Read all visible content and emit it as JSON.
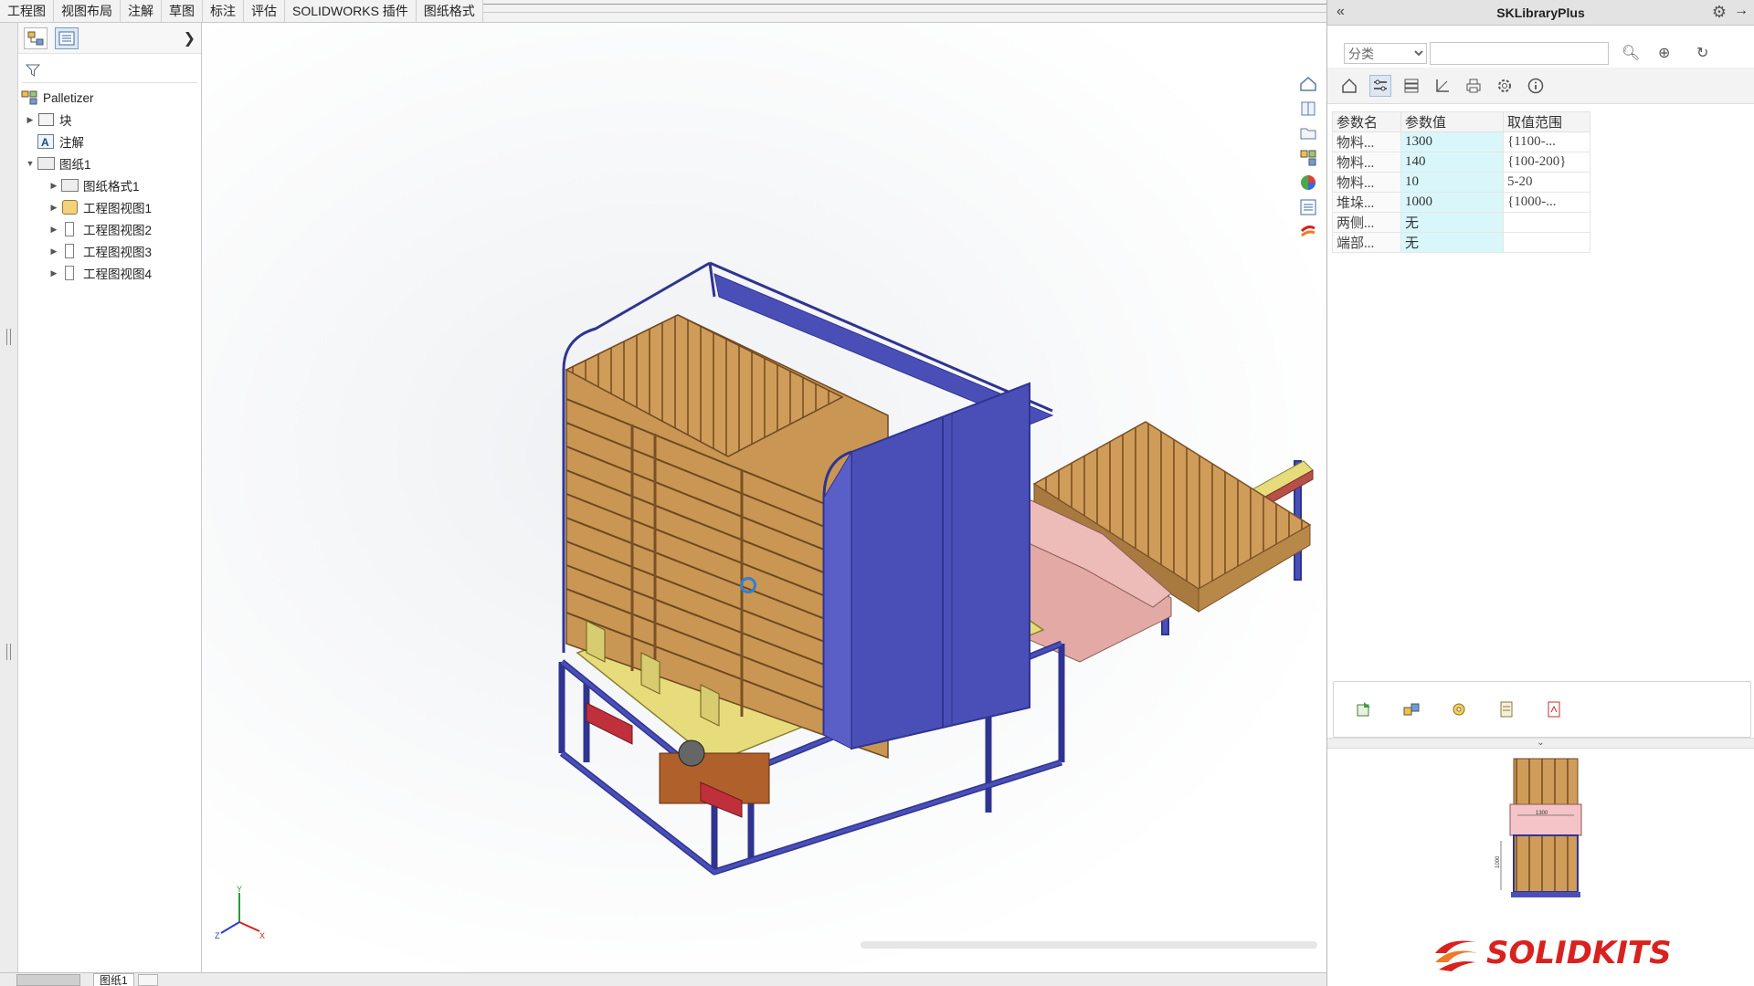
{
  "command_tabs": [
    "工程图",
    "视图布局",
    "注解",
    "草图",
    "标注",
    "评估",
    "SOLIDWORKS 插件",
    "图纸格式"
  ],
  "feature_tree": {
    "root": "Palletizer",
    "items": [
      {
        "label": "块",
        "level": 1,
        "expandable": true,
        "icon": "block-icon"
      },
      {
        "label": "注解",
        "level": 1,
        "expandable": false,
        "icon": "annotation-icon"
      },
      {
        "label": "图纸1",
        "level": 1,
        "expandable": true,
        "expanded": true,
        "icon": "sheet-icon"
      },
      {
        "label": "图纸格式1",
        "level": 2,
        "expandable": true,
        "icon": "sheet-format-icon"
      },
      {
        "label": "工程图视图1",
        "level": 2,
        "expandable": true,
        "icon": "drawing-view-3d-icon"
      },
      {
        "label": "工程图视图2",
        "level": 2,
        "expandable": true,
        "icon": "drawing-view-icon"
      },
      {
        "label": "工程图视图3",
        "level": 2,
        "expandable": true,
        "icon": "drawing-view-icon"
      },
      {
        "label": "工程图视图4",
        "level": 2,
        "expandable": true,
        "icon": "drawing-view-icon"
      }
    ]
  },
  "sheet_tabs": [
    "图纸1"
  ],
  "task_pane": {
    "title": "SKLibraryPlus",
    "category_select": "分类",
    "search_value": "",
    "table": {
      "headers": [
        "参数名",
        "参数值",
        "取值范围"
      ],
      "rows": [
        {
          "name": "物料...",
          "value": "1300",
          "range": "{1100-..."
        },
        {
          "name": "物料...",
          "value": "140",
          "range": "{100-200}"
        },
        {
          "name": "物料...",
          "value": "10",
          "range": "5-20"
        },
        {
          "name": "堆垛...",
          "value": "1000",
          "range": "{1000-..."
        },
        {
          "name": "两侧...",
          "value": "无",
          "range": ""
        },
        {
          "name": "端部...",
          "value": "无",
          "range": ""
        }
      ]
    },
    "preview_dims": [
      "1300",
      "1000"
    ],
    "logo_text": "SOLIDKITS"
  },
  "colors": {
    "frame_blue": "#4a4fb8",
    "pallet_wood": "#c99653",
    "pink_conveyor": "#e3a9a5",
    "value_cell": "#d9f7fb",
    "logo_red": "#d8221f"
  }
}
